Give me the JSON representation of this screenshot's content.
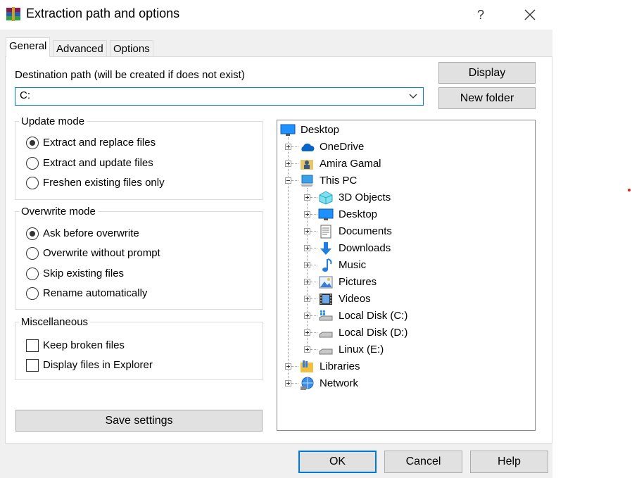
{
  "window": {
    "title": "Extraction path and options",
    "help_glyph": "?",
    "close_glyph": "✕"
  },
  "tabs": [
    {
      "label": "General",
      "active": true
    },
    {
      "label": "Advanced",
      "active": false
    },
    {
      "label": "Options",
      "active": false
    }
  ],
  "destination": {
    "label": "Destination path (will be created if does not exist)",
    "value": "C:"
  },
  "side_buttons": {
    "display": "Display",
    "new_folder": "New folder"
  },
  "update_mode": {
    "title": "Update mode",
    "options": [
      {
        "label": "Extract and replace files",
        "checked": true
      },
      {
        "label": "Extract and update files",
        "checked": false
      },
      {
        "label": "Freshen existing files only",
        "checked": false
      }
    ]
  },
  "overwrite_mode": {
    "title": "Overwrite mode",
    "options": [
      {
        "label": "Ask before overwrite",
        "checked": true
      },
      {
        "label": "Overwrite without prompt",
        "checked": false
      },
      {
        "label": "Skip existing files",
        "checked": false
      },
      {
        "label": "Rename automatically",
        "checked": false
      }
    ]
  },
  "misc": {
    "title": "Miscellaneous",
    "options": [
      {
        "label": "Keep broken files",
        "checked": false
      },
      {
        "label": "Display files in Explorer",
        "checked": false
      }
    ]
  },
  "save_settings": "Save settings",
  "tree": {
    "root": {
      "label": "Desktop",
      "icon": "desktop-icon"
    },
    "items": [
      {
        "label": "OneDrive",
        "icon": "cloud-icon",
        "expander": "plus"
      },
      {
        "label": "Amira Gamal",
        "icon": "user-folder-icon",
        "expander": "plus"
      },
      {
        "label": "This PC",
        "icon": "computer-icon",
        "expander": "minus"
      },
      {
        "label": "3D Objects",
        "icon": "cube-icon",
        "expander": "plus"
      },
      {
        "label": "Desktop",
        "icon": "desktop-icon",
        "expander": "plus"
      },
      {
        "label": "Documents",
        "icon": "document-icon",
        "expander": "plus"
      },
      {
        "label": "Downloads",
        "icon": "download-arrow-icon",
        "expander": "plus"
      },
      {
        "label": "Music",
        "icon": "music-note-icon",
        "expander": "plus"
      },
      {
        "label": "Pictures",
        "icon": "picture-icon",
        "expander": "plus"
      },
      {
        "label": "Videos",
        "icon": "film-icon",
        "expander": "plus"
      },
      {
        "label": "Local Disk (C:)",
        "icon": "system-drive-icon",
        "expander": "plus"
      },
      {
        "label": "Local Disk (D:)",
        "icon": "drive-icon",
        "expander": "plus"
      },
      {
        "label": "Linux (E:)",
        "icon": "drive-icon",
        "expander": "plus"
      },
      {
        "label": "Libraries",
        "icon": "library-icon",
        "expander": "plus"
      },
      {
        "label": "Network",
        "icon": "network-icon",
        "expander": "plus"
      }
    ]
  },
  "footer": {
    "ok": "OK",
    "cancel": "Cancel",
    "help": "Help"
  },
  "colors": {
    "accent": "#0078d7",
    "dialog_bg": "#f0f0f0",
    "button_bg": "#e1e1e1"
  }
}
